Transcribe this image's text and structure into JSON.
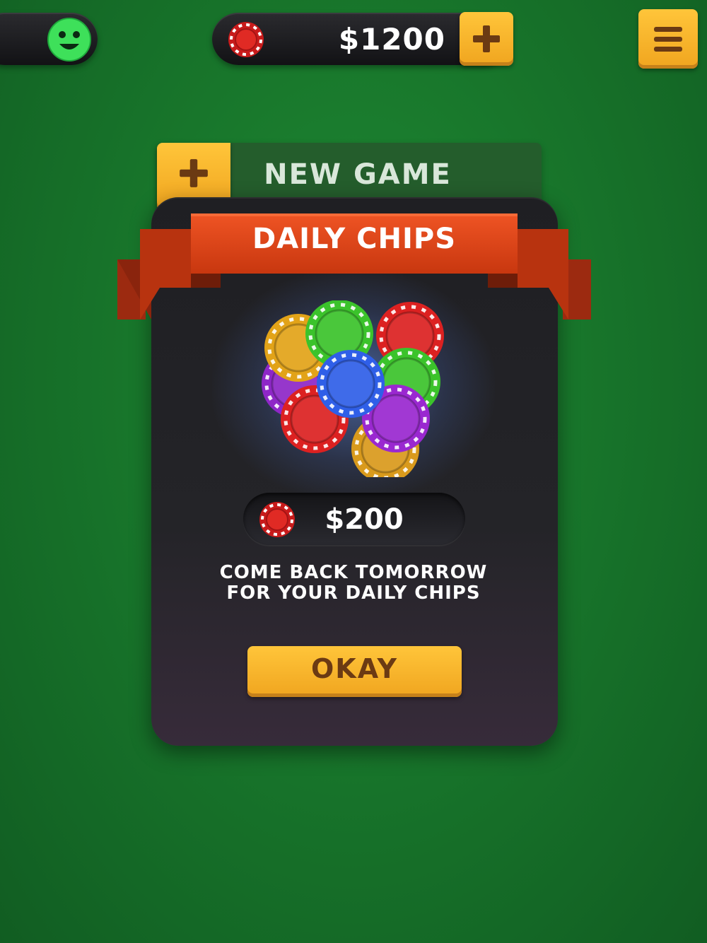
{
  "header": {
    "balance": "$1200",
    "add_chips_icon": "plus-icon",
    "menu_icon": "hamburger-icon",
    "avatar_icon": "smiley-face-icon"
  },
  "new_game": {
    "label": "NEW GAME",
    "icon": "plus-icon"
  },
  "dialog": {
    "title": "DAILY CHIPS",
    "reward_amount": "$200",
    "message_line1": "COME BACK TOMORROW",
    "message_line2": "FOR YOUR DAILY CHIPS",
    "okay_label": "OKAY"
  },
  "colors": {
    "felt": "#18762b",
    "accent_yellow": "#ffc53a",
    "ribbon_red": "#d4411a",
    "dialog_bg": "#242428",
    "button_text": "#6b3a13"
  }
}
